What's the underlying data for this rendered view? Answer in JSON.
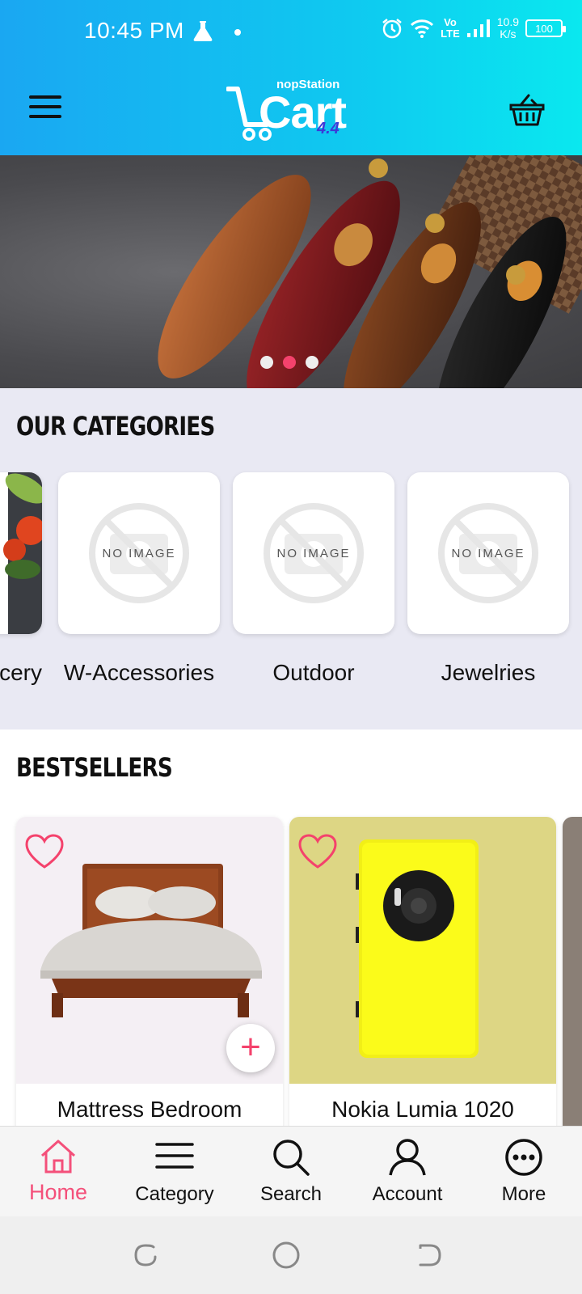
{
  "status_bar": {
    "time": "10:45 PM",
    "network_speed_value": "10.9",
    "network_speed_unit": "K/s",
    "volte_top": "Vo",
    "volte_bottom": "LTE",
    "battery": "100"
  },
  "header": {
    "brand_small": "nopStation",
    "brand_big": "Cart",
    "brand_version": "4.4"
  },
  "banner": {
    "slide_count": 3,
    "active_slide": 2
  },
  "categories": {
    "title": "OUR CATEGORIES",
    "placeholder_text": "NO IMAGE",
    "items": [
      {
        "label": "Grocery",
        "visible_label": "cery"
      },
      {
        "label": "W-Accessories"
      },
      {
        "label": "Outdoor"
      },
      {
        "label": "Jewelries"
      }
    ]
  },
  "bestsellers": {
    "title": "BESTSELLERS",
    "items": [
      {
        "name": "Mattress Bedroom"
      },
      {
        "name": "Nokia Lumia 1020"
      }
    ]
  },
  "bottom_nav": {
    "items": [
      {
        "label": "Home",
        "icon": "home-icon",
        "active": true
      },
      {
        "label": "Category",
        "icon": "menu-lines-icon"
      },
      {
        "label": "Search",
        "icon": "search-icon"
      },
      {
        "label": "Account",
        "icon": "account-icon"
      },
      {
        "label": "More",
        "icon": "more-icon"
      }
    ]
  },
  "colors": {
    "accent": "#f4426c",
    "header_gradient_start": "#1aa7f2",
    "header_gradient_end": "#0ae8ef",
    "categories_bg": "#e9e9f3"
  }
}
